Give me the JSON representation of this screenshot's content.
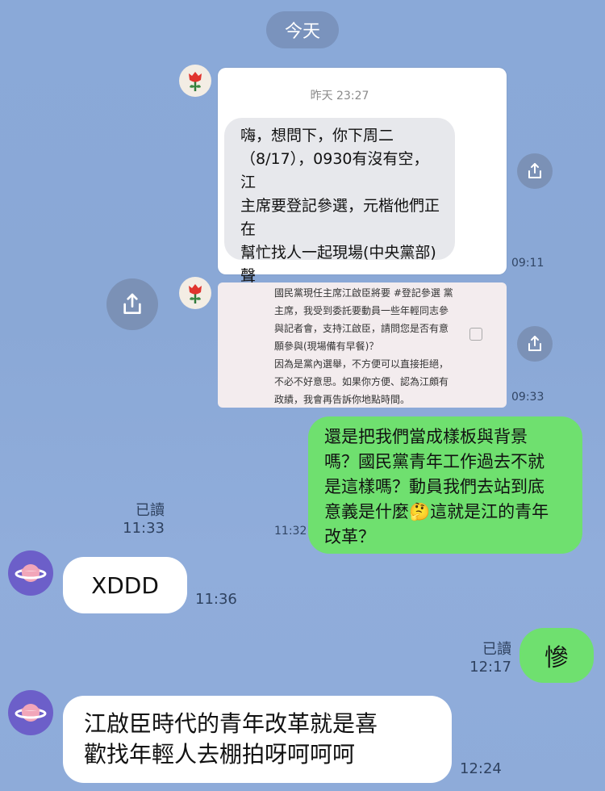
{
  "date_divider": "今天",
  "msg1": {
    "card_time": "昨天 23:27",
    "text": "嗨，想問下，你下周二\n（8/17），0930有沒有空，江\n主席要登記參選，元楷他們正在\n幫忙找人一起現場(中央黨部)聲\n援，看你方不方便～或是幫忙找\n朋友 感謝🙏",
    "time": "09:11"
  },
  "msg2": {
    "image_text": "國民黨現任主席江啟臣將要 #登記參選 黨\n主席，我受到委託要動員一些年輕同志參\n與記者會，支持江啟臣，請問您是否有意\n願參與(現場備有早餐)？\n因為是黨內選舉，不方便可以直接拒絕，\n不必不好意思。如果你方便、認為江頗有\n政績，我會再告訴你地點時間。",
    "time": "09:33"
  },
  "msg3": {
    "read_label": "已讀",
    "read_time": "11:33",
    "text": "還是把我們當成樣板與背景\n嗎？國民黨青年工作過去不就\n是這樣嗎？動員我們去站到底\n意義是什麼🤔這就是江的青年\n改革？",
    "time": "11:32"
  },
  "msg4": {
    "text": "XDDD",
    "time": "11:36"
  },
  "msg5": {
    "read_label": "已讀",
    "time": "12:17",
    "text": "慘"
  },
  "msg6": {
    "text": "江啟臣時代的青年改革就是喜\n歡找年輕人去棚拍呀呵呵呵",
    "time": "12:24"
  },
  "icons": [
    "flower-avatar-icon",
    "planet-avatar-icon",
    "share-icon"
  ],
  "colors": {
    "background": "#8aa9d8",
    "green_bubble": "#6fe06f",
    "share_button": "#7b91b6"
  }
}
